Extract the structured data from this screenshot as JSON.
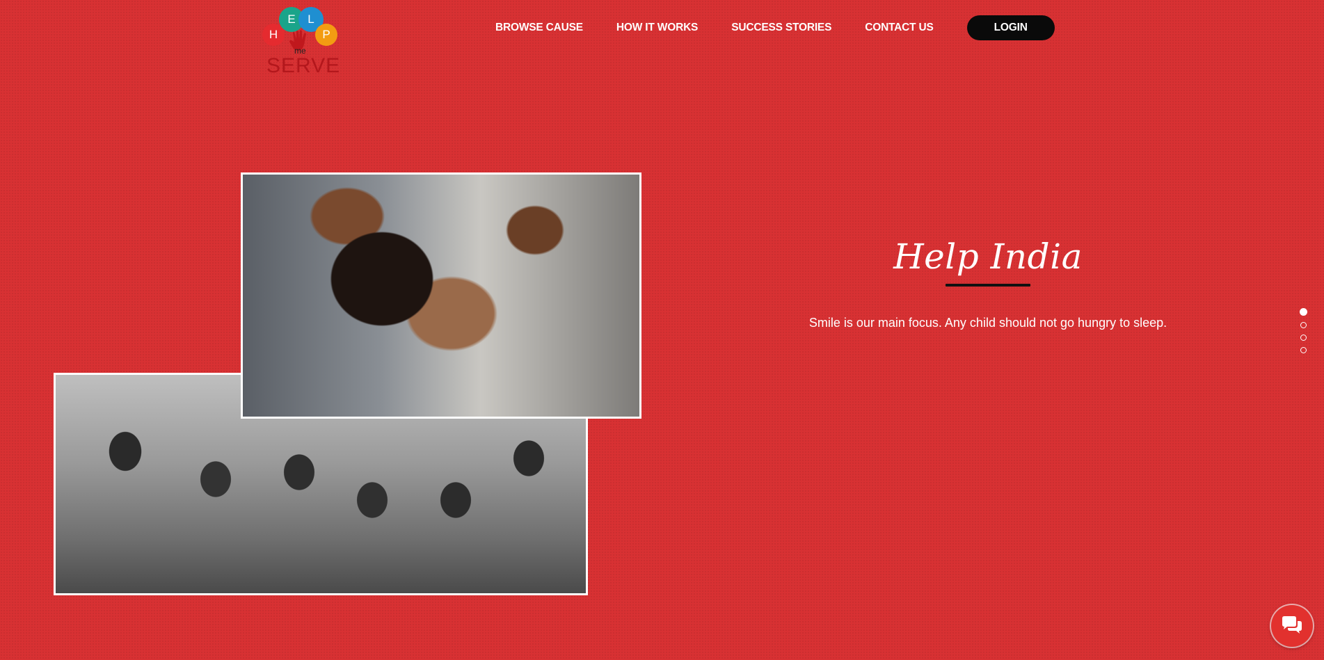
{
  "logo": {
    "letters": [
      "H",
      "E",
      "L",
      "P"
    ],
    "me": "me",
    "serve": "SERVE",
    "colors": {
      "h": "#e52b2f",
      "e": "#1aa48a",
      "l": "#1f8fd1",
      "p": "#f39c12",
      "hand": "#c0181d"
    }
  },
  "nav": {
    "items": [
      {
        "label": "BROWSE CAUSE"
      },
      {
        "label": "HOW IT WORKS"
      },
      {
        "label": "SUCCESS STORIES"
      },
      {
        "label": "CONTACT US"
      }
    ],
    "login_label": "LOGIN"
  },
  "hero": {
    "title": "Help India",
    "subtitle": "Smile is our main focus. Any child should not go hungry to sleep."
  },
  "slider": {
    "count": 4,
    "active_index": 0
  },
  "chat": {
    "icon": "chat-bubbles-icon"
  },
  "colors": {
    "background": "#d83133",
    "text": "#ffffff",
    "login_bg": "#0a0a0a",
    "underline": "#111111"
  }
}
